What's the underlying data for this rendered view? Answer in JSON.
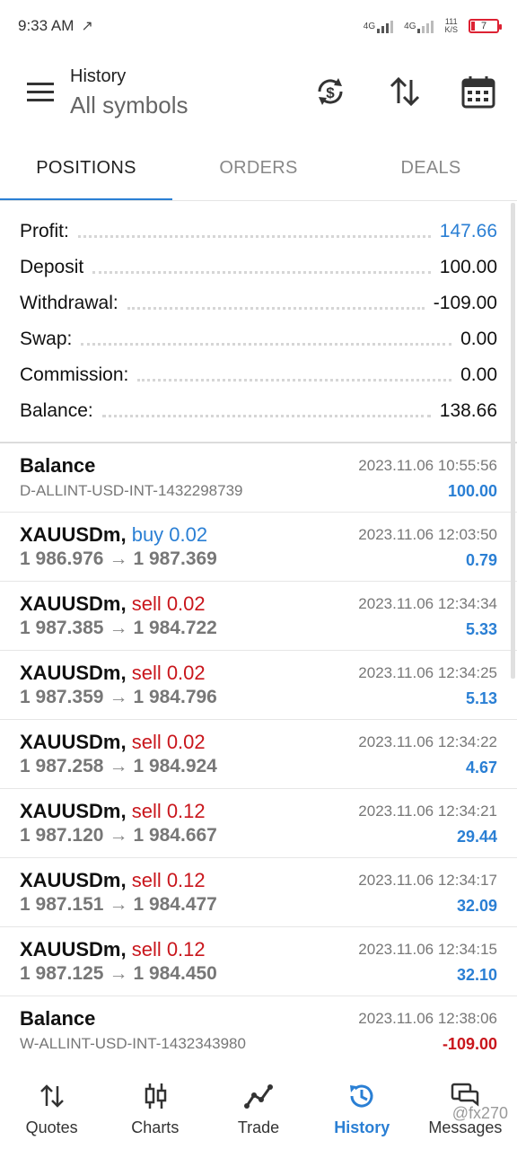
{
  "status": {
    "time": "9:33 AM",
    "net1": "4G",
    "net2": "4G",
    "speed_top": "111",
    "speed_bottom": "K/S",
    "battery": "7"
  },
  "header": {
    "title": "History",
    "subtitle": "All symbols"
  },
  "tabs": [
    "POSITIONS",
    "ORDERS",
    "DEALS"
  ],
  "summary": [
    {
      "label": "Profit:",
      "value": "147.66"
    },
    {
      "label": "Deposit",
      "value": "100.00"
    },
    {
      "label": "Withdrawal:",
      "value": "-109.00"
    },
    {
      "label": "Swap:",
      "value": "0.00"
    },
    {
      "label": "Commission:",
      "value": "0.00"
    },
    {
      "label": "Balance:",
      "value": "138.66"
    }
  ],
  "list": [
    {
      "title": "Balance",
      "sub": "D-ALLINT-USD-INT-1432298739",
      "date": "2023.11.06 10:55:56",
      "value": "100.00"
    },
    {
      "symbol": "XAUUSDm,",
      "side": "buy 0.02",
      "open": "1 986.976",
      "close": "1 987.369",
      "date": "2023.11.06 12:03:50",
      "value": "0.79"
    },
    {
      "symbol": "XAUUSDm,",
      "side": "sell 0.02",
      "open": "1 987.385",
      "close": "1 984.722",
      "date": "2023.11.06 12:34:34",
      "value": "5.33"
    },
    {
      "symbol": "XAUUSDm,",
      "side": "sell 0.02",
      "open": "1 987.359",
      "close": "1 984.796",
      "date": "2023.11.06 12:34:25",
      "value": "5.13"
    },
    {
      "symbol": "XAUUSDm,",
      "side": "sell 0.02",
      "open": "1 987.258",
      "close": "1 984.924",
      "date": "2023.11.06 12:34:22",
      "value": "4.67"
    },
    {
      "symbol": "XAUUSDm,",
      "side": "sell 0.12",
      "open": "1 987.120",
      "close": "1 984.667",
      "date": "2023.11.06 12:34:21",
      "value": "29.44"
    },
    {
      "symbol": "XAUUSDm,",
      "side": "sell 0.12",
      "open": "1 987.151",
      "close": "1 984.477",
      "date": "2023.11.06 12:34:17",
      "value": "32.09"
    },
    {
      "symbol": "XAUUSDm,",
      "side": "sell 0.12",
      "open": "1 987.125",
      "close": "1 984.450",
      "date": "2023.11.06 12:34:15",
      "value": "32.10"
    },
    {
      "title": "Balance",
      "sub": "W-ALLINT-USD-INT-1432343980",
      "date": "2023.11.06 12:38:06",
      "value": "-109.00"
    }
  ],
  "arrow_glyph": "→",
  "nav": [
    "Quotes",
    "Charts",
    "Trade",
    "History",
    "Messages"
  ],
  "watermark": "@fx270",
  "colors": {
    "accent": "#2a7fd4",
    "sell": "#c9161c"
  }
}
